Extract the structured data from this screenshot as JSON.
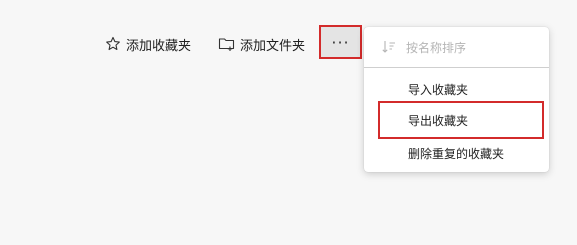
{
  "toolbar": {
    "add_favorite": {
      "label": "添加收藏夹",
      "icon": "star-icon"
    },
    "add_folder": {
      "label": "添加文件夹",
      "icon": "folder-add-icon"
    },
    "more": {
      "label": "···",
      "icon": "more-icon"
    }
  },
  "menu": {
    "sort": {
      "label": "按名称排序",
      "icon": "sort-icon",
      "disabled": true
    },
    "items": [
      {
        "label": "导入收藏夹"
      },
      {
        "label": "导出收藏夹"
      },
      {
        "label": "删除重复的收藏夹"
      }
    ]
  },
  "colors": {
    "highlight": "#d32b2b",
    "background": "#f7f7f7",
    "menu_bg": "#ffffff",
    "disabled_text": "#b5b5b5"
  }
}
